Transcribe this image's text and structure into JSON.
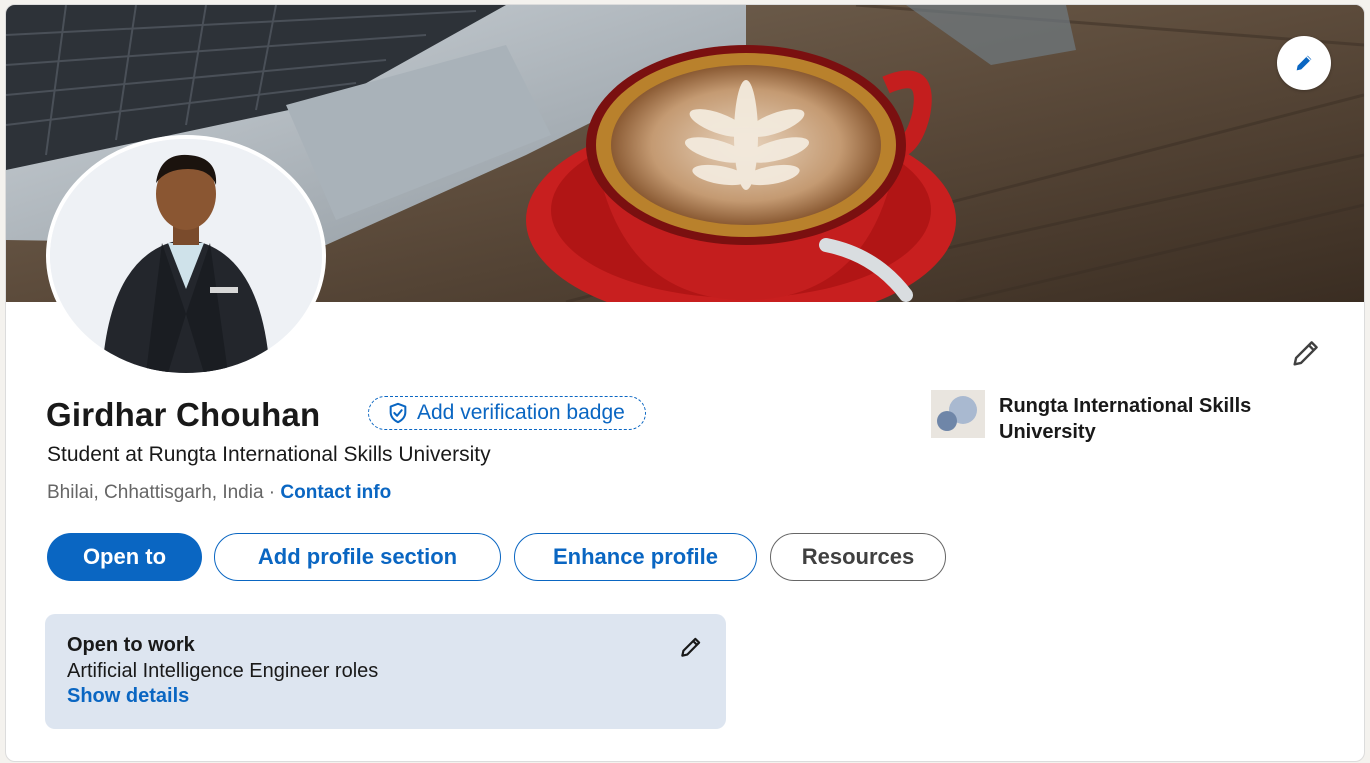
{
  "profile": {
    "name": "Girdhar Chouhan",
    "verification_badge_label": "Add verification badge",
    "headline": "Student at Rungta International Skills University",
    "location": "Bhilai, Chhattisgarh, India",
    "separator": " · ",
    "contact_label": "Contact info"
  },
  "actions": {
    "open_to": "Open to",
    "add_profile_section": "Add profile section",
    "enhance_profile": "Enhance profile",
    "resources": "Resources"
  },
  "organization": {
    "name": "Rungta International Skills University"
  },
  "open_to_work": {
    "title": "Open to work",
    "roles": "Artificial Intelligence Engineer roles",
    "details_link": "Show details"
  },
  "colors": {
    "accent": "#0a66c2",
    "card_background": "#ffffff",
    "open_to_work_background": "#dde5f0"
  },
  "icons": {
    "cover_edit": "pencil-icon",
    "intro_edit": "pencil-icon",
    "badge": "shield-check-icon",
    "open_to_work_edit": "pencil-icon"
  }
}
